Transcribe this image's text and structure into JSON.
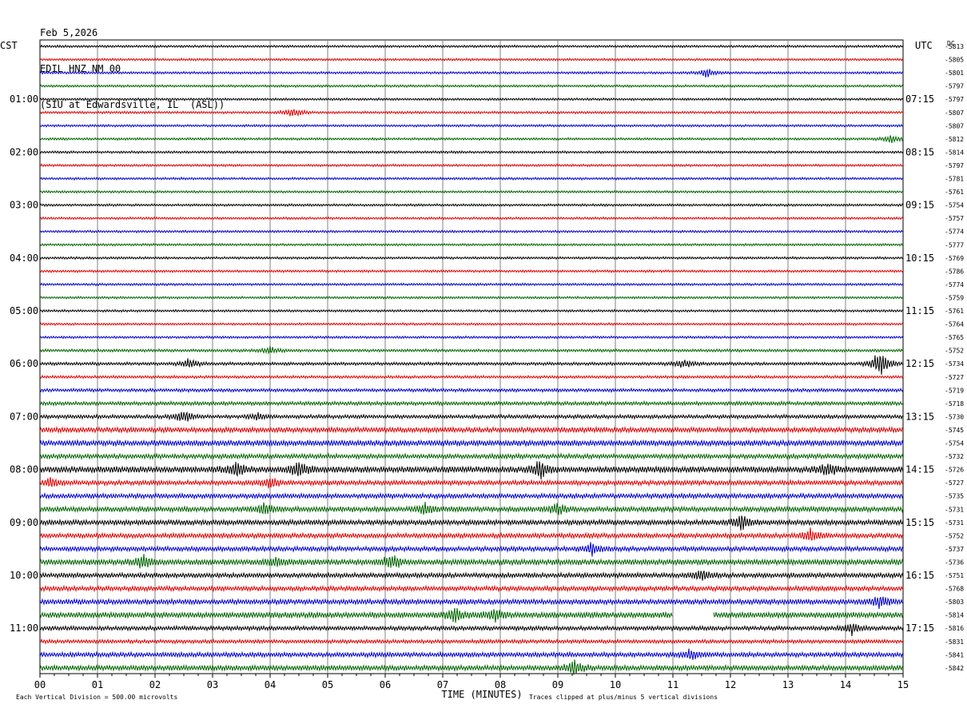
{
  "header": {
    "date": "Feb 5,2026",
    "station": "EDIL HNZ NM 00",
    "location": "(SIU at Edwardsville, IL  (ASL))"
  },
  "left_axis_label": "CST",
  "right_axis_label": "UTC",
  "dc_label": "DC",
  "x_axis_title": "TIME (MINUTES)",
  "footer": {
    "scale_note": "Each Vertical Division =  500.00 microvolts",
    "clip_note": "Traces clipped at plus/minus 5 vertical divisions"
  },
  "colors": {
    "trace_cycle": [
      "#000000",
      "#e00000",
      "#0000d0",
      "#006400"
    ],
    "grid": "#808080",
    "background": "#ffffff"
  },
  "chart_data": {
    "type": "line",
    "title": "",
    "xlabel": "TIME (MINUTES)",
    "ylabel": "",
    "xlim": [
      0,
      15
    ],
    "x_ticks": [
      "00",
      "01",
      "02",
      "03",
      "04",
      "05",
      "06",
      "07",
      "08",
      "09",
      "10",
      "11",
      "12",
      "13",
      "14",
      "15"
    ],
    "left_hour_labels": [
      "01:00",
      "02:00",
      "03:00",
      "04:00",
      "05:00",
      "06:00",
      "07:00",
      "08:00",
      "09:00",
      "10:00",
      "11:00"
    ],
    "right_hour_labels": [
      "07:15",
      "08:15",
      "09:15",
      "10:15",
      "11:15",
      "12:15",
      "13:15",
      "14:15",
      "15:15",
      "16:15",
      "17:15"
    ],
    "trace_dc_offsets": [
      -5813,
      -5805,
      -5801,
      -5797,
      -5797,
      -5807,
      -5807,
      -5812,
      -5814,
      -5797,
      -5781,
      -5761,
      -5754,
      -5757,
      -5774,
      -5777,
      -5769,
      -5786,
      -5774,
      -5759,
      -5761,
      -5764,
      -5765,
      -5752,
      -5734,
      -5727,
      -5719,
      -5718,
      -5730,
      -5745,
      -5754,
      -5732,
      -5726,
      -5727,
      -5735,
      -5731,
      -5731,
      -5752,
      -5737,
      -5736,
      -5751,
      -5768,
      -5803,
      -5814,
      -5816,
      -5831,
      -5841,
      -5842
    ],
    "trace_noise_level": [
      1,
      1,
      1,
      1,
      1,
      1,
      1,
      1,
      1,
      1,
      1,
      1,
      1,
      1,
      1,
      1,
      1,
      1,
      1,
      1,
      1,
      1,
      1,
      1.2,
      1.3,
      1.2,
      1.4,
      1.6,
      1.6,
      2.2,
      2.4,
      2,
      2.6,
      2,
      2,
      2.2,
      2.2,
      2,
      2,
      2.4,
      2,
      2,
      2.2,
      2.4,
      1.8,
      1.6,
      2,
      2.2
    ],
    "events": [
      {
        "trace": 2,
        "minute": 11.6,
        "amplitude": 4
      },
      {
        "trace": 5,
        "minute": 4.4,
        "amplitude": 5
      },
      {
        "trace": 7,
        "minute": 14.8,
        "amplitude": 4
      },
      {
        "trace": 23,
        "minute": 4.0,
        "amplitude": 3
      },
      {
        "trace": 24,
        "minute": 2.6,
        "amplitude": 5
      },
      {
        "trace": 24,
        "minute": 11.2,
        "amplitude": 5
      },
      {
        "trace": 24,
        "minute": 14.6,
        "amplitude": 14
      },
      {
        "trace": 28,
        "minute": 2.5,
        "amplitude": 6
      },
      {
        "trace": 28,
        "minute": 3.8,
        "amplitude": 3
      },
      {
        "trace": 32,
        "minute": 3.4,
        "amplitude": 7
      },
      {
        "trace": 32,
        "minute": 4.5,
        "amplitude": 8
      },
      {
        "trace": 32,
        "minute": 8.7,
        "amplitude": 8
      },
      {
        "trace": 32,
        "minute": 13.7,
        "amplitude": 6
      },
      {
        "trace": 33,
        "minute": 0.2,
        "amplitude": 5
      },
      {
        "trace": 33,
        "minute": 4.0,
        "amplitude": 5
      },
      {
        "trace": 35,
        "minute": 3.9,
        "amplitude": 5
      },
      {
        "trace": 35,
        "minute": 6.7,
        "amplitude": 5
      },
      {
        "trace": 35,
        "minute": 9.0,
        "amplitude": 5
      },
      {
        "trace": 36,
        "minute": 12.2,
        "amplitude": 7
      },
      {
        "trace": 37,
        "minute": 13.4,
        "amplitude": 7
      },
      {
        "trace": 38,
        "minute": 9.6,
        "amplitude": 6
      },
      {
        "trace": 39,
        "minute": 1.8,
        "amplitude": 6
      },
      {
        "trace": 39,
        "minute": 4.1,
        "amplitude": 5
      },
      {
        "trace": 39,
        "minute": 6.1,
        "amplitude": 8
      },
      {
        "trace": 40,
        "minute": 11.5,
        "amplitude": 5
      },
      {
        "trace": 42,
        "minute": 14.6,
        "amplitude": 6
      },
      {
        "trace": 43,
        "minute": 7.2,
        "amplitude": 7
      },
      {
        "trace": 43,
        "minute": 7.9,
        "amplitude": 6
      },
      {
        "trace": 44,
        "minute": 14.1,
        "amplitude": 6
      },
      {
        "trace": 46,
        "minute": 11.3,
        "amplitude": 5
      },
      {
        "trace": 47,
        "minute": 9.3,
        "amplitude": 7
      }
    ],
    "data_gaps": [
      {
        "trace": 43,
        "start_minute": 11.0,
        "end_minute": 11.7
      }
    ],
    "grid": true
  }
}
